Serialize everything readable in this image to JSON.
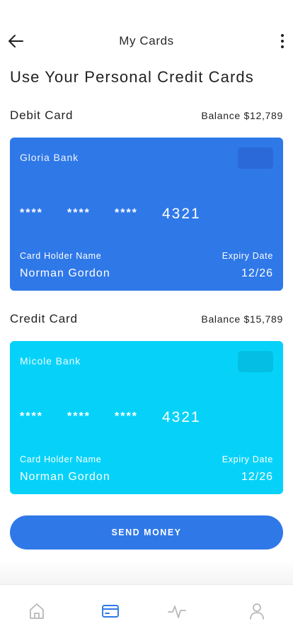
{
  "header": {
    "title": "My Cards",
    "back_icon": "arrow-left-icon",
    "more_icon": "more-vertical-icon"
  },
  "page_title": "Use Your Personal Credit Cards",
  "debit": {
    "label": "Debit Card",
    "balance": "Balance $12,789",
    "card": {
      "bank": "Gloria Bank",
      "groups": [
        "****",
        "****",
        "****"
      ],
      "last4": "4321",
      "holder_label": "Card Holder Name",
      "holder_name": "Norman Gordon",
      "expiry_label": "Expiry Date",
      "expiry": "12/26",
      "color": "#2f78e8"
    }
  },
  "credit": {
    "label": "Credit Card",
    "balance": "Balance $15,789",
    "card": {
      "bank": "Micole Bank",
      "groups": [
        "****",
        "****",
        "****"
      ],
      "last4": "4321",
      "holder_label": "Card Holder Name",
      "holder_name": "Norman Gordon",
      "expiry_label": "Expiry Date",
      "expiry": "12/26",
      "color": "#06d2f9"
    }
  },
  "send_button": "SEND MONEY",
  "bottom_nav": {
    "items": [
      {
        "icon": "home-icon",
        "active": false
      },
      {
        "icon": "card-icon",
        "active": true
      },
      {
        "icon": "activity-icon",
        "active": false
      },
      {
        "icon": "user-icon",
        "active": false
      }
    ],
    "active_color": "#2f78e8",
    "inactive_color": "#b8b8b8"
  }
}
